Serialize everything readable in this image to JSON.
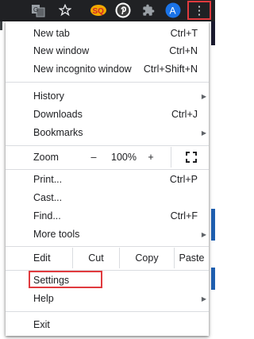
{
  "toolbar": {
    "icons": [
      "translate-icon",
      "star-icon",
      "extension-sq-icon",
      "pinterest-icon",
      "puzzle-icon",
      "avatar",
      "more-options-icon"
    ],
    "sq_text": "SQ",
    "avatar_letter": "A",
    "kebab_glyph": "⋮",
    "highlight_color": "#e03a3e"
  },
  "menu": {
    "new_tab": {
      "label": "New tab",
      "shortcut": "Ctrl+T"
    },
    "new_window": {
      "label": "New window",
      "shortcut": "Ctrl+N"
    },
    "new_incognito": {
      "label": "New incognito window",
      "shortcut": "Ctrl+Shift+N"
    },
    "history": {
      "label": "History"
    },
    "downloads": {
      "label": "Downloads",
      "shortcut": "Ctrl+J"
    },
    "bookmarks": {
      "label": "Bookmarks"
    },
    "zoom": {
      "label": "Zoom",
      "minus": "–",
      "value": "100%",
      "plus": "+"
    },
    "print": {
      "label": "Print...",
      "shortcut": "Ctrl+P"
    },
    "cast": {
      "label": "Cast..."
    },
    "find": {
      "label": "Find...",
      "shortcut": "Ctrl+F"
    },
    "more_tools": {
      "label": "More tools"
    },
    "edit": {
      "label": "Edit",
      "cut": "Cut",
      "copy": "Copy",
      "paste": "Paste"
    },
    "settings": {
      "label": "Settings"
    },
    "help": {
      "label": "Help"
    },
    "exit": {
      "label": "Exit"
    },
    "submenu_arrow": "▶"
  }
}
